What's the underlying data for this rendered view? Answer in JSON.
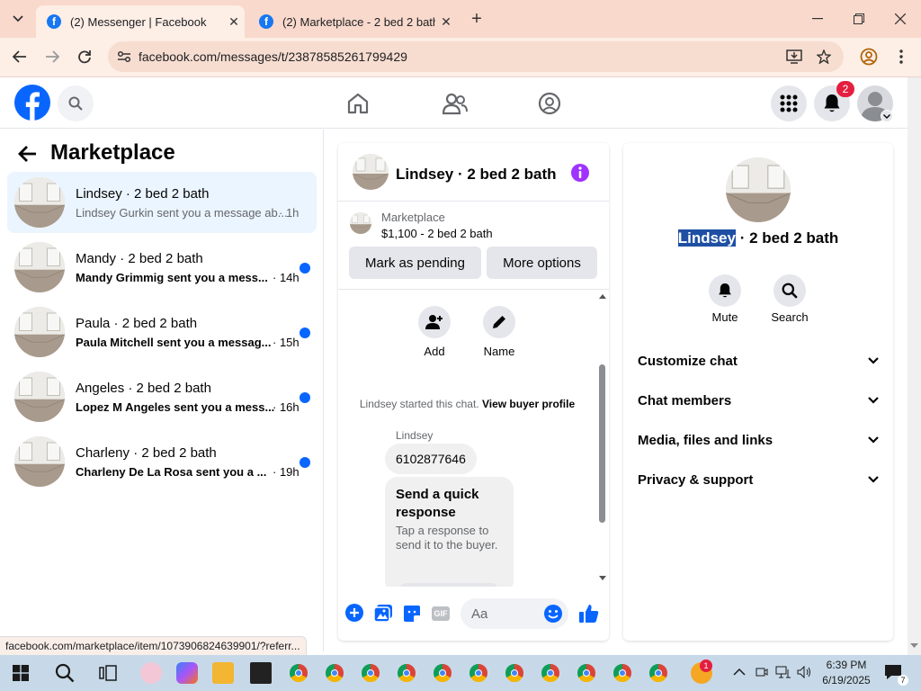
{
  "browser": {
    "tabs": [
      {
        "title": "(2) Messenger | Facebook",
        "active": true
      },
      {
        "title": "(2) Marketplace - 2 bed 2 bath",
        "active": false
      }
    ],
    "url": "facebook.com/messages/t/23878585261799429",
    "status_url": "facebook.com/marketplace/item/1073906824639901/?referr..."
  },
  "header": {
    "notification_count": "2"
  },
  "sidebar": {
    "title": "Marketplace",
    "conversations": [
      {
        "name": "Lindsey · 2 bed 2 bath",
        "snippet": "Lindsey Gurkin sent you a message ab...",
        "time": "· 1h",
        "unread": false
      },
      {
        "name": "Mandy · 2 bed 2 bath",
        "snippet": "Mandy Grimmig sent you a mess...",
        "time": "· 14h",
        "unread": true
      },
      {
        "name": "Paula · 2 bed 2 bath",
        "snippet": "Paula Mitchell sent you a messag...",
        "time": "· 15h",
        "unread": true
      },
      {
        "name": "Angeles · 2 bed 2 bath",
        "snippet": "Lopez M Angeles sent you a mess...",
        "time": "· 16h",
        "unread": true
      },
      {
        "name": "Charleny · 2 bed 2 bath",
        "snippet": "Charleny De La Rosa sent you a ...",
        "time": "· 19h",
        "unread": true
      }
    ]
  },
  "chat": {
    "title": "Lindsey · 2 bed 2 bath",
    "listing_label": "Marketplace",
    "listing_price": "$1,100 - 2 bed 2 bath",
    "mark_pending": "Mark as pending",
    "more_options": "More options",
    "add_label": "Add",
    "name_label": "Name",
    "started_text": "Lindsey started this chat.",
    "view_profile": "View buyer profile",
    "sender": "Lindsey",
    "message": "6102877646",
    "quick_title": "Send a quick response",
    "quick_sub": "Tap a response to send it to the buyer.",
    "composer_placeholder": "Aa"
  },
  "info": {
    "name_highlight": "Lindsey",
    "name_rest": " · 2 bed 2 bath",
    "mute": "Mute",
    "search": "Search",
    "sections": [
      "Customize chat",
      "Chat members",
      "Media, files and links",
      "Privacy & support"
    ]
  },
  "taskbar": {
    "time": "6:39 PM",
    "date": "6/19/2025",
    "notif_badge": "7"
  },
  "colors": {
    "facebook_blue": "#0866ff",
    "messenger_purple": "#a033ff",
    "tab_bar": "#f9d9cc"
  }
}
